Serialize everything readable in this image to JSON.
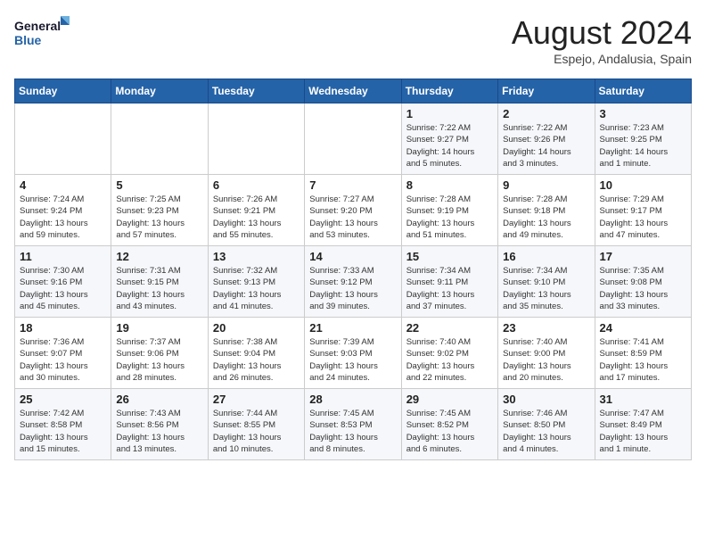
{
  "logo": {
    "line1": "General",
    "line2": "Blue"
  },
  "title": "August 2024",
  "location": "Espejo, Andalusia, Spain",
  "weekdays": [
    "Sunday",
    "Monday",
    "Tuesday",
    "Wednesday",
    "Thursday",
    "Friday",
    "Saturday"
  ],
  "weeks": [
    [
      {
        "day": "",
        "info": ""
      },
      {
        "day": "",
        "info": ""
      },
      {
        "day": "",
        "info": ""
      },
      {
        "day": "",
        "info": ""
      },
      {
        "day": "1",
        "info": "Sunrise: 7:22 AM\nSunset: 9:27 PM\nDaylight: 14 hours\nand 5 minutes."
      },
      {
        "day": "2",
        "info": "Sunrise: 7:22 AM\nSunset: 9:26 PM\nDaylight: 14 hours\nand 3 minutes."
      },
      {
        "day": "3",
        "info": "Sunrise: 7:23 AM\nSunset: 9:25 PM\nDaylight: 14 hours\nand 1 minute."
      }
    ],
    [
      {
        "day": "4",
        "info": "Sunrise: 7:24 AM\nSunset: 9:24 PM\nDaylight: 13 hours\nand 59 minutes."
      },
      {
        "day": "5",
        "info": "Sunrise: 7:25 AM\nSunset: 9:23 PM\nDaylight: 13 hours\nand 57 minutes."
      },
      {
        "day": "6",
        "info": "Sunrise: 7:26 AM\nSunset: 9:21 PM\nDaylight: 13 hours\nand 55 minutes."
      },
      {
        "day": "7",
        "info": "Sunrise: 7:27 AM\nSunset: 9:20 PM\nDaylight: 13 hours\nand 53 minutes."
      },
      {
        "day": "8",
        "info": "Sunrise: 7:28 AM\nSunset: 9:19 PM\nDaylight: 13 hours\nand 51 minutes."
      },
      {
        "day": "9",
        "info": "Sunrise: 7:28 AM\nSunset: 9:18 PM\nDaylight: 13 hours\nand 49 minutes."
      },
      {
        "day": "10",
        "info": "Sunrise: 7:29 AM\nSunset: 9:17 PM\nDaylight: 13 hours\nand 47 minutes."
      }
    ],
    [
      {
        "day": "11",
        "info": "Sunrise: 7:30 AM\nSunset: 9:16 PM\nDaylight: 13 hours\nand 45 minutes."
      },
      {
        "day": "12",
        "info": "Sunrise: 7:31 AM\nSunset: 9:15 PM\nDaylight: 13 hours\nand 43 minutes."
      },
      {
        "day": "13",
        "info": "Sunrise: 7:32 AM\nSunset: 9:13 PM\nDaylight: 13 hours\nand 41 minutes."
      },
      {
        "day": "14",
        "info": "Sunrise: 7:33 AM\nSunset: 9:12 PM\nDaylight: 13 hours\nand 39 minutes."
      },
      {
        "day": "15",
        "info": "Sunrise: 7:34 AM\nSunset: 9:11 PM\nDaylight: 13 hours\nand 37 minutes."
      },
      {
        "day": "16",
        "info": "Sunrise: 7:34 AM\nSunset: 9:10 PM\nDaylight: 13 hours\nand 35 minutes."
      },
      {
        "day": "17",
        "info": "Sunrise: 7:35 AM\nSunset: 9:08 PM\nDaylight: 13 hours\nand 33 minutes."
      }
    ],
    [
      {
        "day": "18",
        "info": "Sunrise: 7:36 AM\nSunset: 9:07 PM\nDaylight: 13 hours\nand 30 minutes."
      },
      {
        "day": "19",
        "info": "Sunrise: 7:37 AM\nSunset: 9:06 PM\nDaylight: 13 hours\nand 28 minutes."
      },
      {
        "day": "20",
        "info": "Sunrise: 7:38 AM\nSunset: 9:04 PM\nDaylight: 13 hours\nand 26 minutes."
      },
      {
        "day": "21",
        "info": "Sunrise: 7:39 AM\nSunset: 9:03 PM\nDaylight: 13 hours\nand 24 minutes."
      },
      {
        "day": "22",
        "info": "Sunrise: 7:40 AM\nSunset: 9:02 PM\nDaylight: 13 hours\nand 22 minutes."
      },
      {
        "day": "23",
        "info": "Sunrise: 7:40 AM\nSunset: 9:00 PM\nDaylight: 13 hours\nand 20 minutes."
      },
      {
        "day": "24",
        "info": "Sunrise: 7:41 AM\nSunset: 8:59 PM\nDaylight: 13 hours\nand 17 minutes."
      }
    ],
    [
      {
        "day": "25",
        "info": "Sunrise: 7:42 AM\nSunset: 8:58 PM\nDaylight: 13 hours\nand 15 minutes."
      },
      {
        "day": "26",
        "info": "Sunrise: 7:43 AM\nSunset: 8:56 PM\nDaylight: 13 hours\nand 13 minutes."
      },
      {
        "day": "27",
        "info": "Sunrise: 7:44 AM\nSunset: 8:55 PM\nDaylight: 13 hours\nand 10 minutes."
      },
      {
        "day": "28",
        "info": "Sunrise: 7:45 AM\nSunset: 8:53 PM\nDaylight: 13 hours\nand 8 minutes."
      },
      {
        "day": "29",
        "info": "Sunrise: 7:45 AM\nSunset: 8:52 PM\nDaylight: 13 hours\nand 6 minutes."
      },
      {
        "day": "30",
        "info": "Sunrise: 7:46 AM\nSunset: 8:50 PM\nDaylight: 13 hours\nand 4 minutes."
      },
      {
        "day": "31",
        "info": "Sunrise: 7:47 AM\nSunset: 8:49 PM\nDaylight: 13 hours\nand 1 minute."
      }
    ]
  ]
}
